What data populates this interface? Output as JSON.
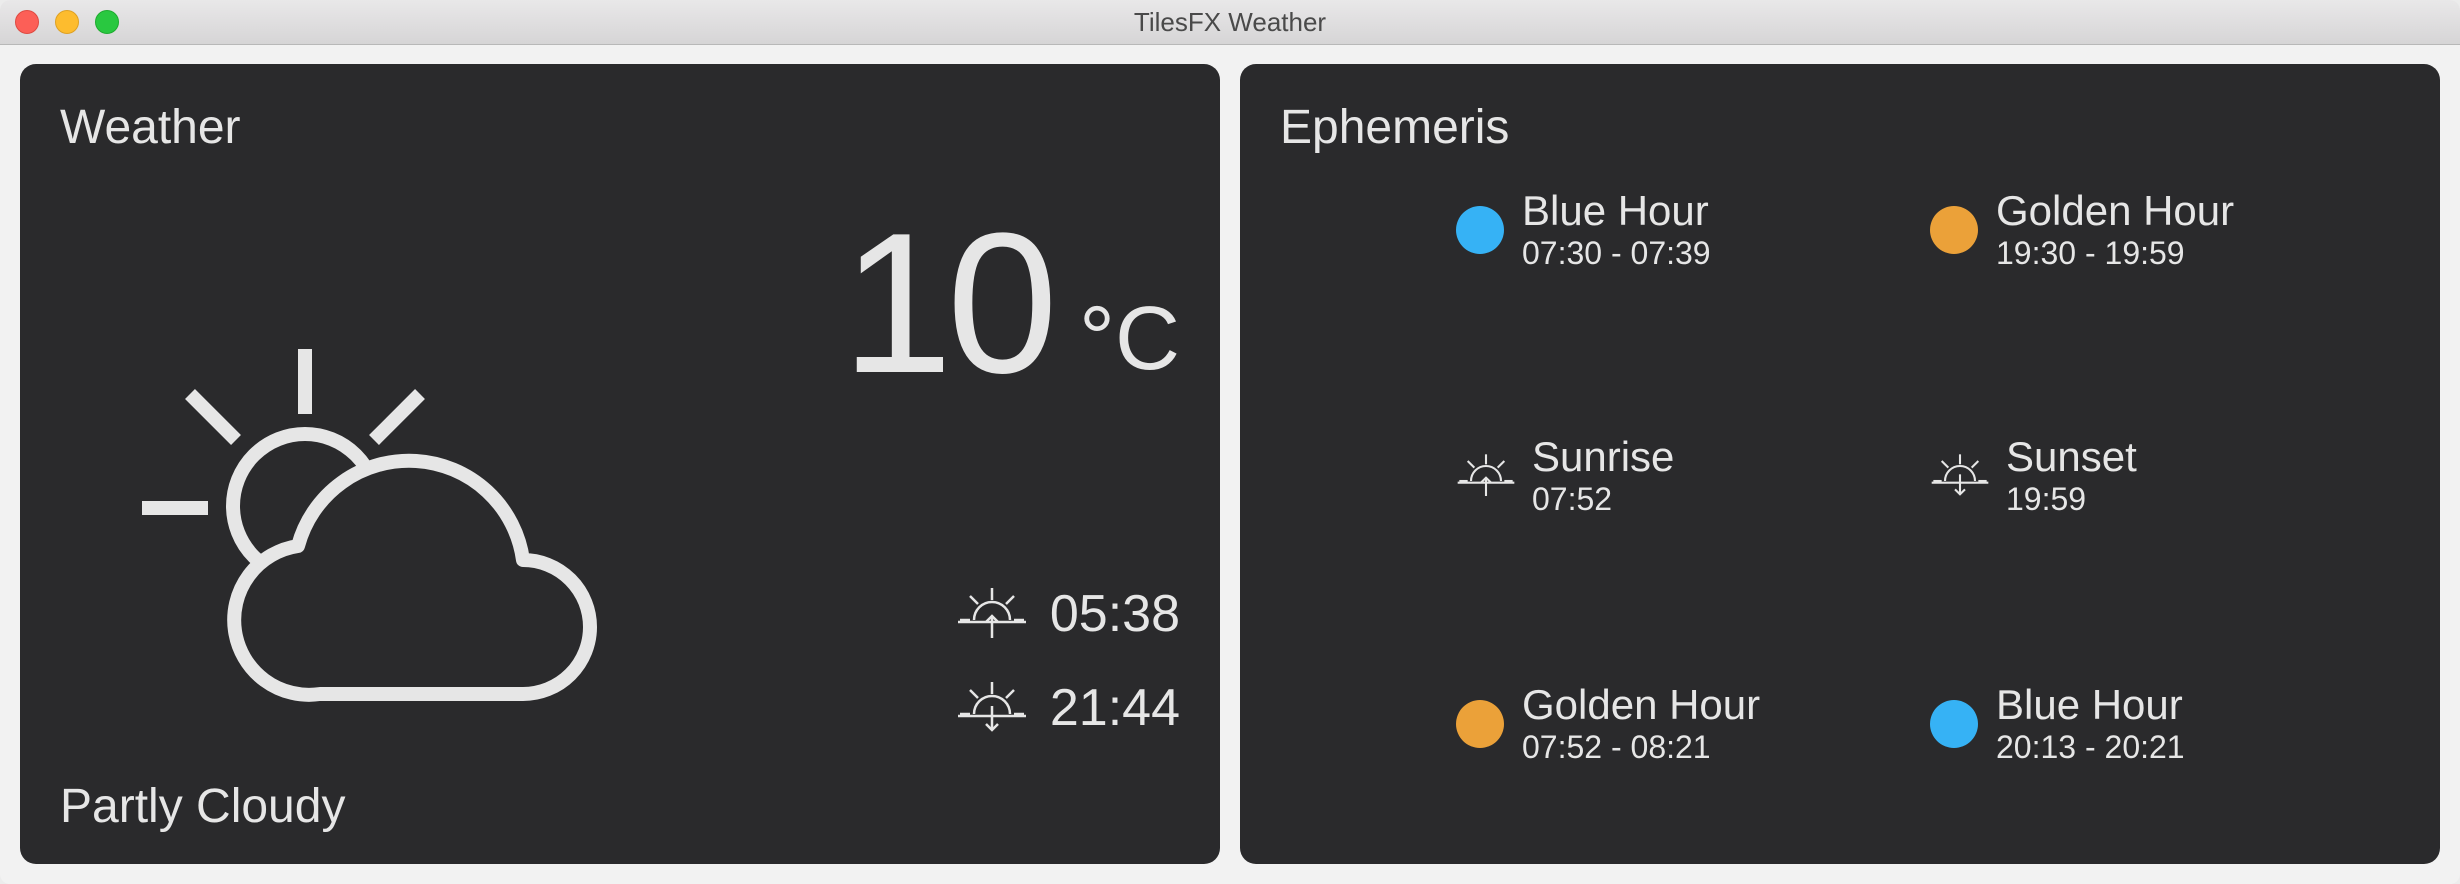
{
  "window": {
    "title": "TilesFX Weather"
  },
  "weather_tile": {
    "title": "Weather",
    "temperature": "10",
    "unit": "°C",
    "sunrise_time": "05:38",
    "sunset_time": "21:44",
    "condition": "Partly Cloudy",
    "icon": "partly-cloudy-icon"
  },
  "ephemeris_tile": {
    "title": "Ephemeris",
    "items": [
      {
        "label": "Blue Hour",
        "value": "07:30 - 07:39",
        "icon": "dot",
        "color": "#36b2f5"
      },
      {
        "label": "Golden Hour",
        "value": "19:30 - 19:59",
        "icon": "dot",
        "color": "#eba139"
      },
      {
        "label": "Sunrise",
        "value": "07:52",
        "icon": "sunrise-icon"
      },
      {
        "label": "Sunset",
        "value": "19:59",
        "icon": "sunset-icon"
      },
      {
        "label": "Golden Hour",
        "value": "07:52 - 08:21",
        "icon": "dot",
        "color": "#eba139"
      },
      {
        "label": "Blue Hour",
        "value": "20:13 - 20:21",
        "icon": "dot",
        "color": "#36b2f5"
      }
    ]
  },
  "colors": {
    "tile_background": "#2a2a2c",
    "text": "#e6e6e6",
    "blue_hour": "#36b2f5",
    "golden_hour": "#eba139"
  }
}
